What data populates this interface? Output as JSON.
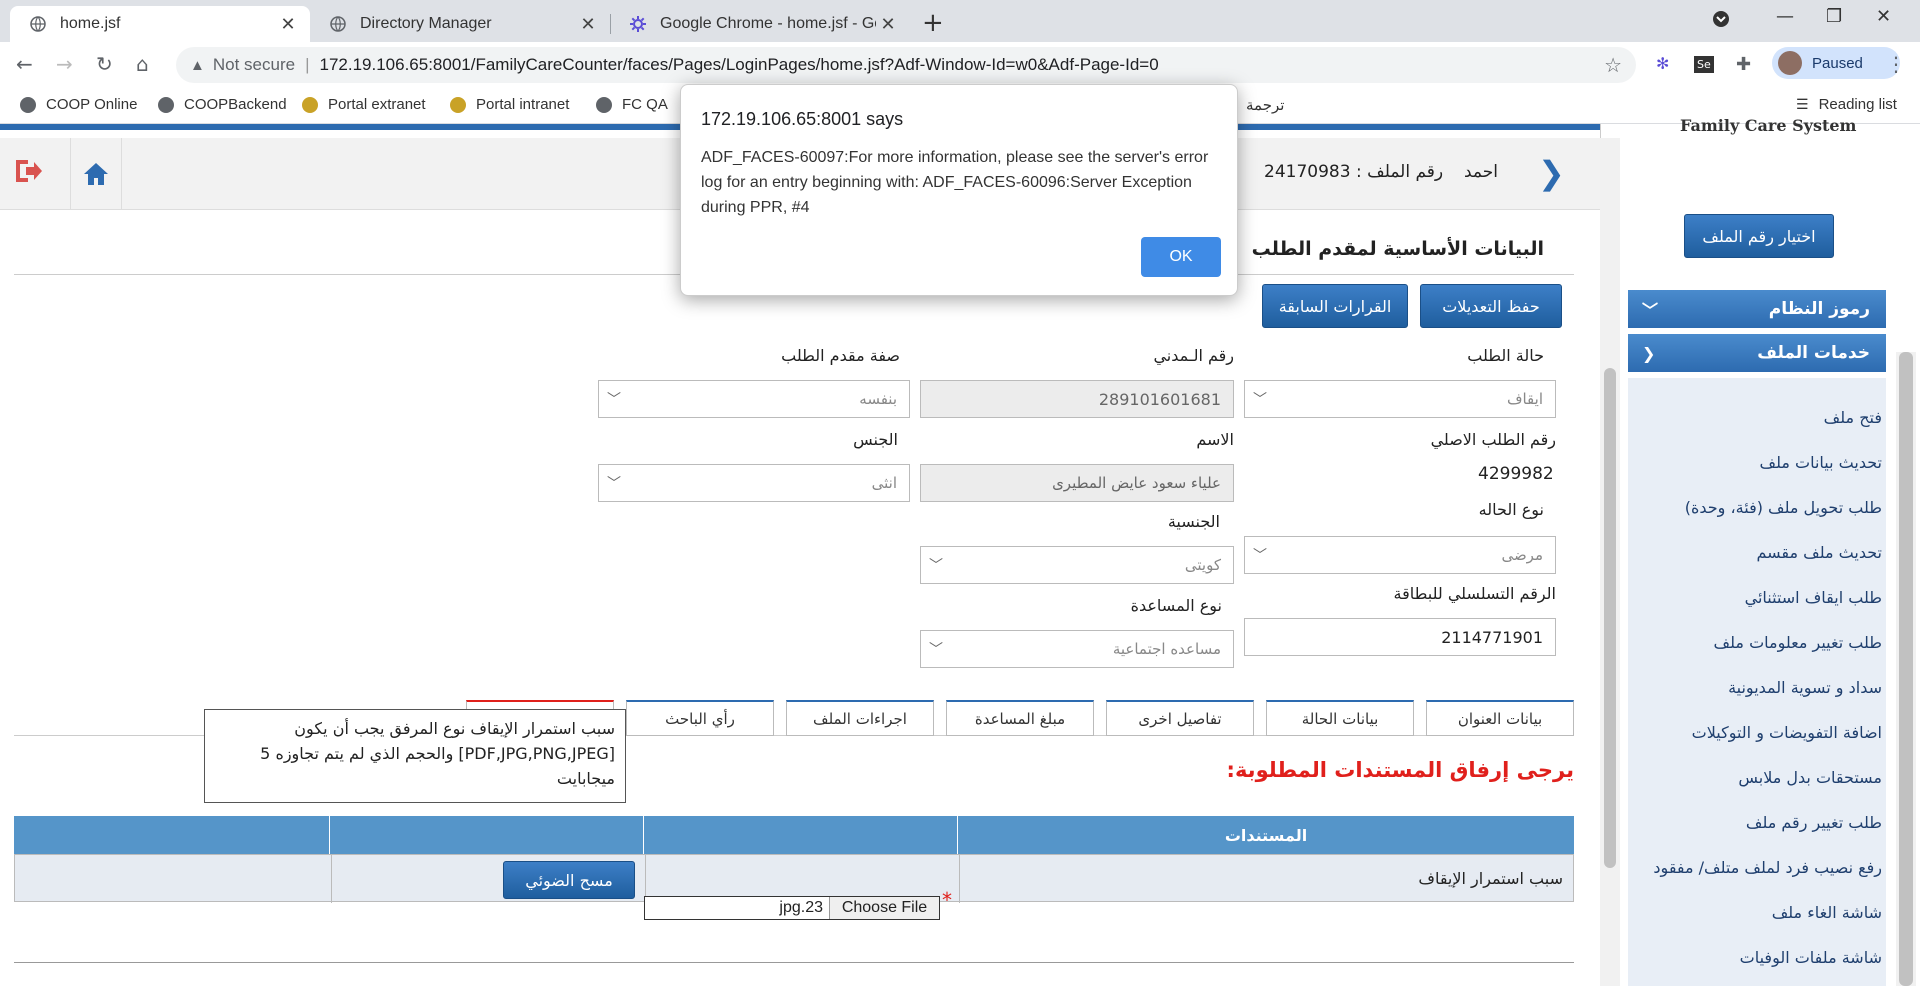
{
  "browser": {
    "tabs": [
      {
        "title": "home.jsf"
      },
      {
        "title": "Directory Manager"
      },
      {
        "title": "Google Chrome - home.jsf - Goo"
      }
    ],
    "not_secure": "Not secure",
    "url": "172.19.106.65:8001/FamilyCareCounter/faces/Pages/LoginPages/home.jsf?Adf-Window-Id=w0&Adf-Page-Id=0",
    "profile_status": "Paused",
    "reading_list": "Reading list",
    "bookmarks": [
      "COOP Online",
      "COOPBackend",
      "Portal extranet",
      "Portal intranet",
      "FC QA",
      "ترجمة"
    ]
  },
  "dialog": {
    "title": "172.19.106.65:8001 says",
    "message": "ADF_FACES-60097:For more information, please see the server's error log for an entry beginning with: ADF_FACES-60096:Server Exception during PPR, #4",
    "ok": "OK"
  },
  "header": {
    "name": "احمد",
    "file_label": "رقم الملف :",
    "file_number": "24170983"
  },
  "page": {
    "section_title": "البيانات الأساسية لمقدم الطلب",
    "save_button": "حفظ التعديلات",
    "prev_decisions_button": "القرارات السابقة"
  },
  "form": {
    "request_status": {
      "label": "حالة الطلب",
      "value": "ايقاف"
    },
    "civil_id": {
      "label": "رقم الـمدني",
      "value": "289101601681"
    },
    "applicant_type": {
      "label": "صفة مقدم الطلب",
      "value": "بنفسه"
    },
    "original_request": {
      "label": "رقم الطلب الاصلي",
      "value": "4299982"
    },
    "name": {
      "label": "الاسم",
      "value": "علياء سعود عايض المطيرى"
    },
    "gender": {
      "label": "الجنس",
      "value": "انثى"
    },
    "case_type": {
      "label": "نوع الحاله",
      "value": "مرضى"
    },
    "nationality": {
      "label": "الجنسية",
      "value": "كويتى"
    },
    "card_serial": {
      "label": "الرقم التسلسلي للبطاقة",
      "value": "2114771901"
    },
    "assistance_type": {
      "label": "نوع المساعدة",
      "value": "مساعده اجتماعية"
    }
  },
  "tabs": [
    "بيانات العنوان",
    "بيانات الحالة",
    "تفاصيل اخرى",
    "مبلغ المساعدة",
    "اجراءات الملف",
    "رأي الباحث"
  ],
  "tooltip": "سبب استمرار الإيقاف نوع المرفق يجب أن يكون [PDF,JPG,PNG,JPEG] والحجم الذي لم يتم تجاوزه 5 ميجابايت",
  "documents": {
    "title": "يرجى إرفاق المستندات المطلوبة:",
    "header": "المستندات",
    "row_label": "سبب استمرار الإيقاف",
    "file_name": "jpg.23",
    "choose_file": "Choose File",
    "scan_button": "مسح الضوئي"
  },
  "sidebar": {
    "system_title": "Family Care System",
    "choose_file_button": "اختيار رقم الملف",
    "groups": [
      "رموز النظام",
      "خدمات الملف"
    ],
    "items": [
      "فتح ملف",
      "تحديث بيانات ملف",
      "طلب تحويل ملف (فئة، وحدة)",
      "تحديث ملف مقسم",
      "طلب ايقاف استثنائي",
      "طلب تغيير معلومات ملف",
      "سداد و تسوية المديونية",
      "اضافة التفويضات و التوكيلات",
      "مستحقات بدل ملابس",
      "طلب تغيير رقم ملف",
      "رفع نصيب فرد لملف متلف/ مفقود",
      "شاشة الغاء ملف",
      "شاشة ملفات الوفيات"
    ]
  },
  "colors": {
    "brand_blue": "#2d6bb0",
    "error_red": "#e0201c",
    "dialog_ok": "#3f8be6"
  }
}
